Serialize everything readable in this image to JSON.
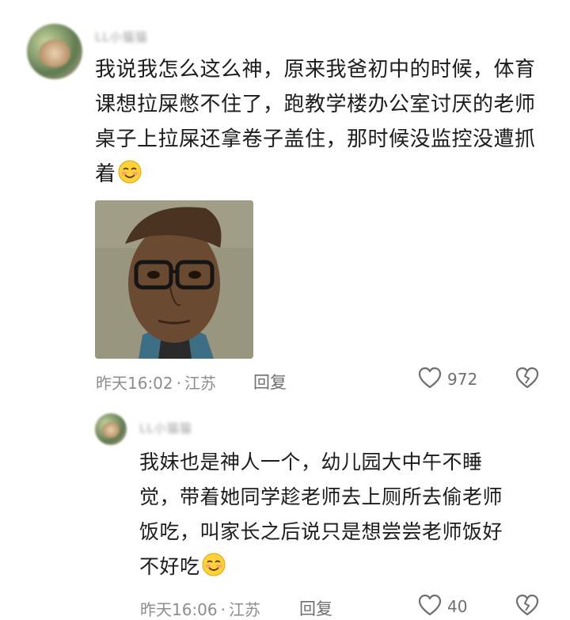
{
  "comment1": {
    "username": "LL小猫猫",
    "lines": [
      "我说我怎么这么神，原来我爸初中的时候，体育",
      "课想拉屎憋不住了，跑教学楼办公室讨厌的老师",
      "桌子上拉屎还拿卷子盖住，那时候没监控没遭抓",
      "着"
    ],
    "time": "昨天16:02",
    "location": "江苏",
    "reply_label": "回复",
    "likes": "972",
    "emoji_icon": "smiling-face-emoji"
  },
  "comment2": {
    "username": "LL小猫猫",
    "lines": [
      "我妹也是神人一个，幼儿园大中午不睡",
      "觉，带着她同学趁老师去上厕所去偷老师",
      "饭吃，叫家长之后说只是想尝尝老师饭好",
      "不好吃"
    ],
    "time": "昨天16:06",
    "location": "江苏",
    "reply_label": "回复",
    "likes": "40",
    "emoji_icon": "smiling-face-emoji"
  },
  "colors": {
    "text": "#1c1c1c",
    "meta": "#8d8d8d",
    "icon": "#6f6f6f",
    "background": "#ffffff"
  }
}
